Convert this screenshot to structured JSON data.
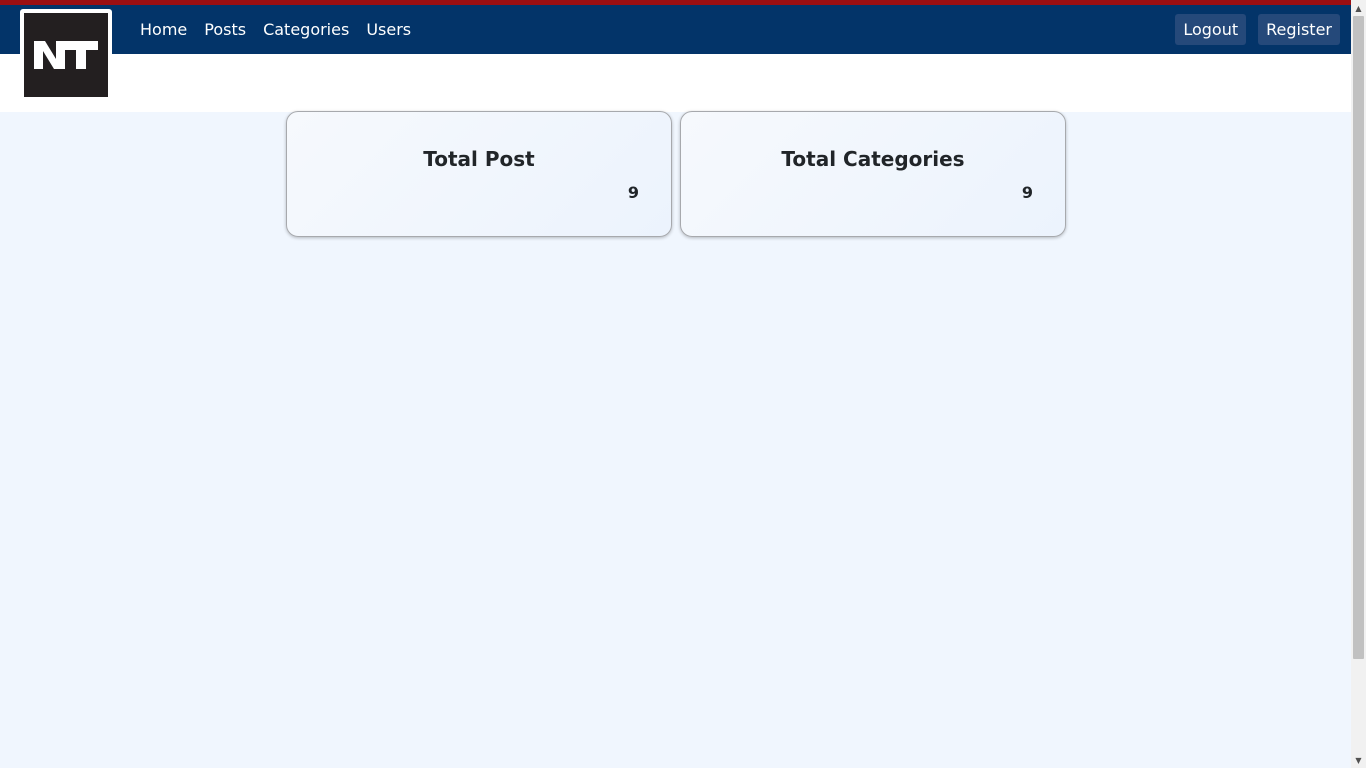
{
  "nav": {
    "logo_text": "NT",
    "links": [
      "Home",
      "Posts",
      "Categories",
      "Users"
    ],
    "logout_label": "Logout",
    "register_label": "Register"
  },
  "cards": [
    {
      "title": "Total Post",
      "value": "9"
    },
    {
      "title": "Total Categories",
      "value": "9"
    }
  ],
  "colors": {
    "navbar": "#033469",
    "topline": "#9b0f12",
    "page_bg": "#f0f6fe",
    "button_bg": "#25497a"
  }
}
